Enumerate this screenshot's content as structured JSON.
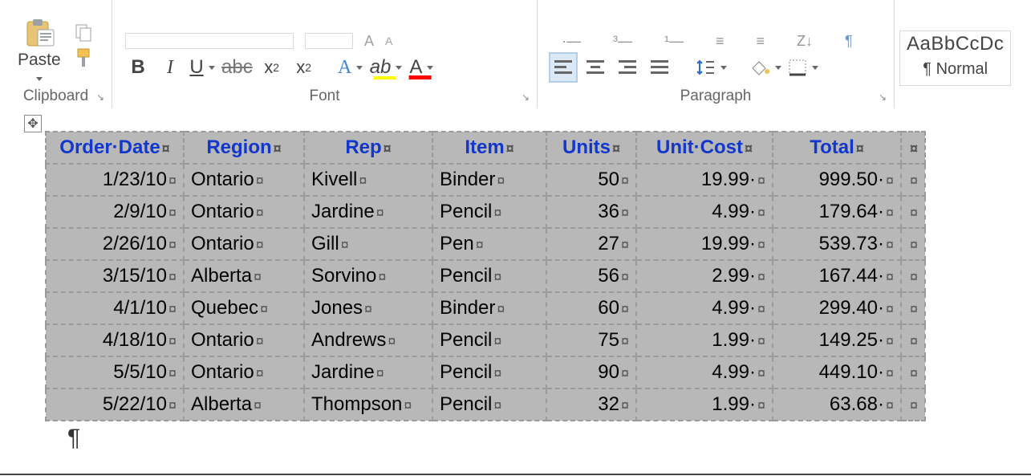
{
  "ribbon": {
    "clipboard": {
      "group_label": "Clipboard",
      "paste_label": "Paste"
    },
    "font": {
      "group_label": "Font",
      "bold": "B",
      "italic": "I",
      "underline": "U",
      "strike": "abc",
      "subscript": "x",
      "subscript_ind": "2",
      "superscript": "x",
      "superscript_ind": "2",
      "text_effects": "A",
      "highlight": "ab",
      "font_color": "A"
    },
    "paragraph": {
      "group_label": "Paragraph"
    },
    "styles": {
      "preview": "AaBbCcDc",
      "name": "¶ Normal"
    }
  },
  "table": {
    "headers": [
      "Order·Date",
      "Region",
      "Rep",
      "Item",
      "Units",
      "Unit·Cost",
      "Total"
    ],
    "mark": "¤",
    "rows": [
      {
        "date": "1/23/10",
        "region": "Ontario",
        "rep": "Kivell",
        "item": "Binder",
        "units": "50",
        "cost": "19.99·",
        "total": "999.50·"
      },
      {
        "date": "2/9/10",
        "region": "Ontario",
        "rep": "Jardine",
        "item": "Pencil",
        "units": "36",
        "cost": "4.99·",
        "total": "179.64·"
      },
      {
        "date": "2/26/10",
        "region": "Ontario",
        "rep": "Gill",
        "item": "Pen",
        "units": "27",
        "cost": "19.99·",
        "total": "539.73·"
      },
      {
        "date": "3/15/10",
        "region": "Alberta",
        "rep": "Sorvino",
        "item": "Pencil",
        "units": "56",
        "cost": "2.99·",
        "total": "167.44·"
      },
      {
        "date": "4/1/10",
        "region": "Quebec",
        "rep": "Jones",
        "item": "Binder",
        "units": "60",
        "cost": "4.99·",
        "total": "299.40·"
      },
      {
        "date": "4/18/10",
        "region": "Ontario",
        "rep": "Andrews",
        "item": "Pencil",
        "units": "75",
        "cost": "1.99·",
        "total": "149.25·"
      },
      {
        "date": "5/5/10",
        "region": "Ontario",
        "rep": "Jardine",
        "item": "Pencil",
        "units": "90",
        "cost": "4.99·",
        "total": "449.10·"
      },
      {
        "date": "5/22/10",
        "region": "Alberta",
        "rep": "Thompson",
        "item": "Pencil",
        "units": "32",
        "cost": "1.99·",
        "total": "63.68·"
      }
    ],
    "end_pilcrow": "¶"
  }
}
